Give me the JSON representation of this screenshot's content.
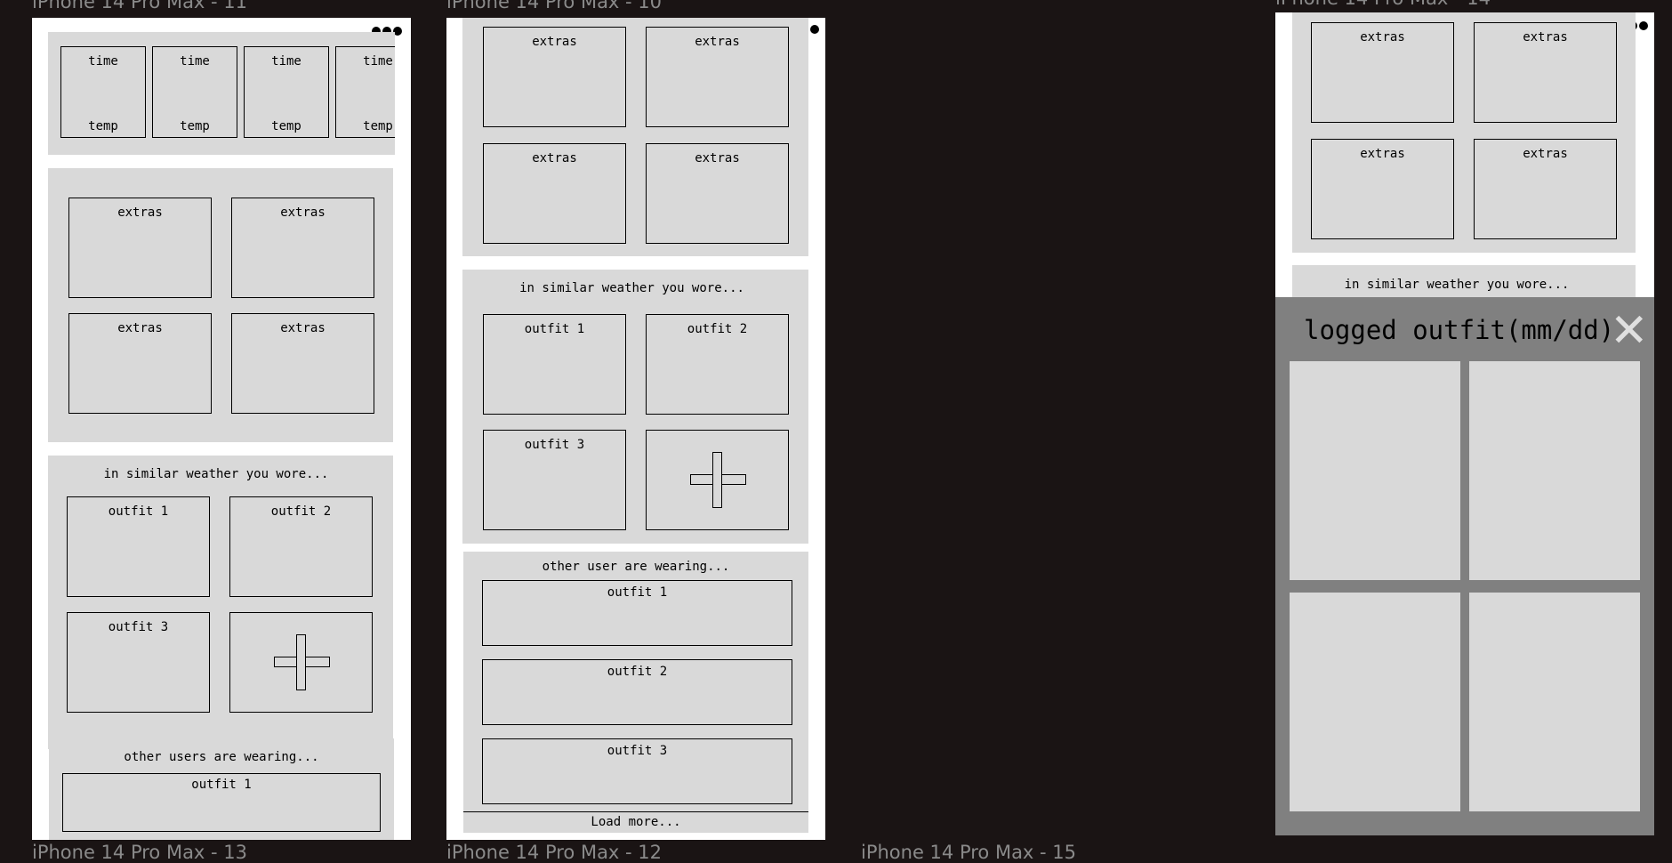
{
  "frame_labels": {
    "p11": "iPhone 14 Pro Max - 11",
    "p10": "iPhone 14 Pro Max - 10",
    "p14": "iPhone 14 Pro Max - 14",
    "p13": "iPhone 14 Pro Max - 13",
    "p12": "iPhone 14 Pro Max - 12",
    "p15": "iPhone 14 Pro Max - 15"
  },
  "forecast": {
    "time_label": "time",
    "temp_label": "temp"
  },
  "extras_label": "extras",
  "similar_weather": {
    "heading": "in similar weather you wore...",
    "outfits": [
      "outfit 1",
      "outfit 2",
      "outfit 3"
    ]
  },
  "other_users": {
    "heading_p11": "other users are wearing...",
    "heading_p10": "other user are wearing...",
    "outfits": [
      "outfit 1",
      "outfit 2",
      "outfit 3"
    ],
    "load_more": "Load more..."
  },
  "logged_modal": {
    "title": "logged outfit(mm/dd)",
    "close_glyph": "✕"
  },
  "icons": {
    "menu": "more-dots-icon",
    "add": "plus-icon",
    "close": "close-icon"
  }
}
